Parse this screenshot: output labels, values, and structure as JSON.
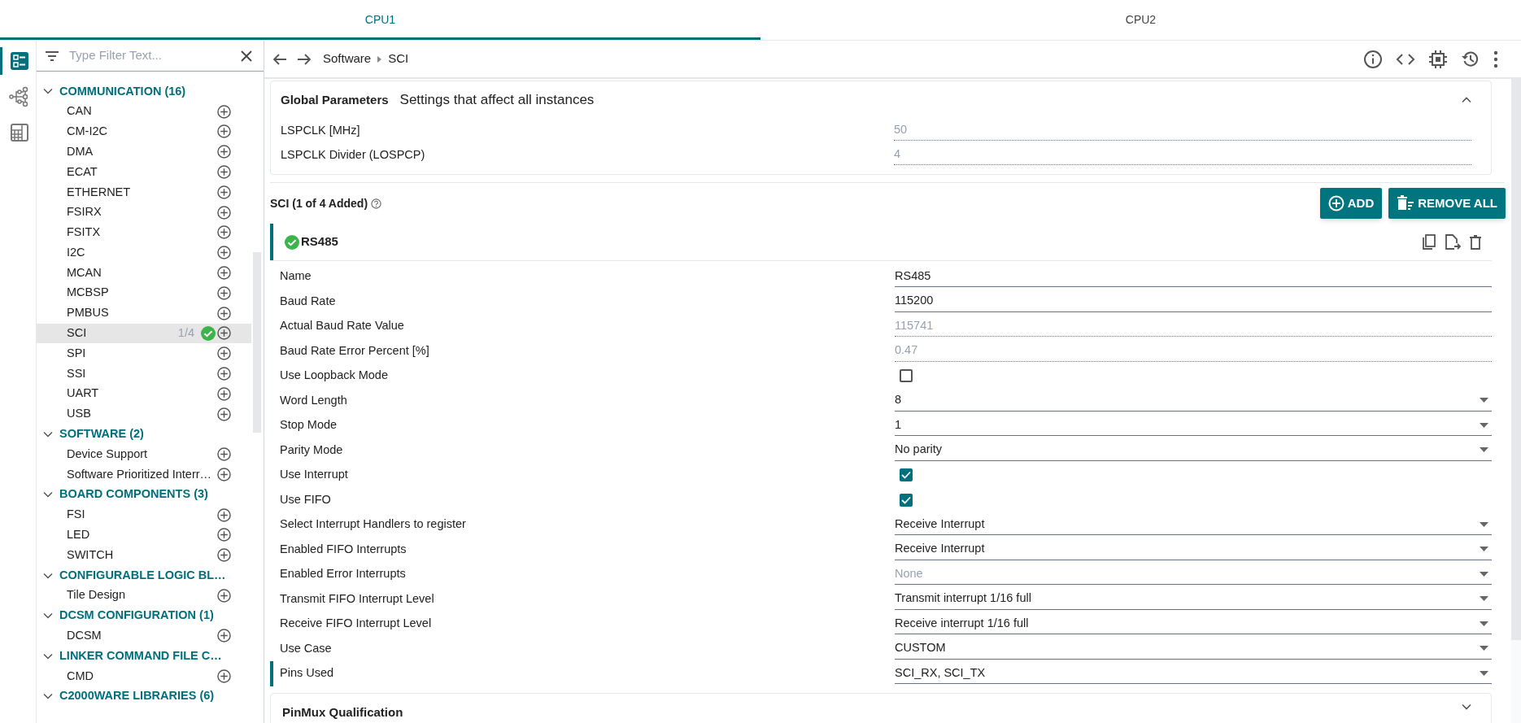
{
  "tabs": [
    {
      "label": "CPU1",
      "selected": true
    },
    {
      "label": "CPU2",
      "selected": false
    }
  ],
  "rail": [
    {
      "selected": true
    },
    {
      "selected": false
    },
    {
      "selected": false
    }
  ],
  "sidebar": {
    "filter": {
      "placeholder": "Type Filter Text..."
    },
    "groups": [
      {
        "title": "COMMUNICATION (16)",
        "expanded": true,
        "items": [
          {
            "label": "CAN",
            "selected": false
          },
          {
            "label": "CM-I2C",
            "selected": false
          },
          {
            "label": "DMA",
            "selected": false
          },
          {
            "label": "ECAT",
            "selected": false
          },
          {
            "label": "ETHERNET",
            "selected": false
          },
          {
            "label": "FSIRX",
            "selected": false
          },
          {
            "label": "FSITX",
            "selected": false
          },
          {
            "label": "I2C",
            "selected": false
          },
          {
            "label": "MCAN",
            "selected": false
          },
          {
            "label": "MCBSP",
            "selected": false
          },
          {
            "label": "PMBUS",
            "selected": false
          },
          {
            "label": "SCI",
            "selected": true,
            "count": "1/4",
            "configured": true
          },
          {
            "label": "SPI",
            "selected": false
          },
          {
            "label": "SSI",
            "selected": false
          },
          {
            "label": "UART",
            "selected": false
          },
          {
            "label": "USB",
            "selected": false
          }
        ]
      },
      {
        "title": "SOFTWARE (2)",
        "expanded": true,
        "items": [
          {
            "label": "Device Support",
            "selected": false
          },
          {
            "label": "Software Prioritized Interr…",
            "selected": false
          }
        ]
      },
      {
        "title": "BOARD COMPONENTS (3)",
        "expanded": true,
        "items": [
          {
            "label": "FSI",
            "selected": false
          },
          {
            "label": "LED",
            "selected": false
          },
          {
            "label": "SWITCH",
            "selected": false
          }
        ]
      },
      {
        "title": "CONFIGURABLE LOGIC BL…",
        "expanded": true,
        "items": [
          {
            "label": "Tile Design",
            "selected": false
          }
        ]
      },
      {
        "title": "DCSM CONFIGURATION (1)",
        "expanded": true,
        "items": [
          {
            "label": "DCSM",
            "selected": false
          }
        ]
      },
      {
        "title": "LINKER COMMAND FILE C…",
        "expanded": true,
        "items": [
          {
            "label": "CMD",
            "selected": false
          }
        ]
      },
      {
        "title": "C2000WARE LIBRARIES (6)",
        "expanded": true
      }
    ]
  },
  "breadcrumb": [
    "Software",
    "SCI"
  ],
  "global_parameters": {
    "title": "Global Parameters",
    "subtitle": "Settings that affect all instances",
    "expanded": true,
    "params": [
      {
        "label": "LSPCLK [MHz]",
        "value": "50"
      },
      {
        "label": "LSPCLK Divider (LOSPCP)",
        "value": "4"
      }
    ]
  },
  "module": {
    "title": "SCI (1 of 4 Added)",
    "buttons": [
      {
        "label": "ADD",
        "kind": "add"
      },
      {
        "label": "REMOVE ALL",
        "kind": "remove"
      }
    ],
    "instance": {
      "name": "RS485",
      "valid": true,
      "fields": [
        {
          "label": "Name",
          "kind": "text",
          "value": "RS485"
        },
        {
          "label": "Baud Rate",
          "kind": "text",
          "value": "115200"
        },
        {
          "label": "Actual Baud Rate Value",
          "kind": "readonly",
          "value": "115741"
        },
        {
          "label": "Baud Rate Error Percent [%]",
          "kind": "readonly",
          "value": "0.47"
        },
        {
          "label": "Use Loopback Mode",
          "kind": "checkbox",
          "checked": false
        },
        {
          "label": "Word Length",
          "kind": "select",
          "value": "8"
        },
        {
          "label": "Stop Mode",
          "kind": "select",
          "value": "1"
        },
        {
          "label": "Parity Mode",
          "kind": "select",
          "value": "No parity"
        },
        {
          "label": "Use Interrupt",
          "kind": "checkbox",
          "checked": true
        },
        {
          "label": "Use FIFO",
          "kind": "checkbox",
          "checked": true
        },
        {
          "label": "Select Interrupt Handlers to register",
          "kind": "select",
          "value": "Receive Interrupt"
        },
        {
          "label": "Enabled FIFO Interrupts",
          "kind": "select",
          "value": "Receive Interrupt"
        },
        {
          "label": "Enabled Error Interrupts",
          "kind": "select",
          "placeholder": "None"
        },
        {
          "label": "Transmit FIFO Interrupt Level",
          "kind": "select",
          "value": "Transmit interrupt 1/16 full"
        },
        {
          "label": "Receive FIFO Interrupt Level",
          "kind": "select",
          "value": "Receive interrupt 1/16 full"
        },
        {
          "label": "Use Case",
          "kind": "select",
          "value": "CUSTOM"
        },
        {
          "label": "Pins Used",
          "kind": "select",
          "value": "SCI_RX, SCI_TX",
          "marked": true
        }
      ]
    }
  },
  "pinmux": {
    "title": "PinMux Qualification",
    "expanded": false
  }
}
